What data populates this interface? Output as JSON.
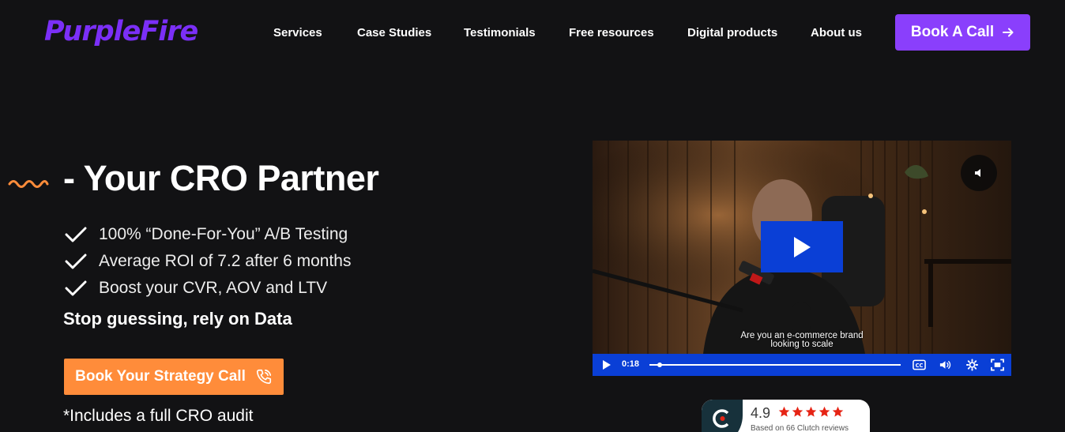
{
  "brand": {
    "logo_text": "PurpleFire",
    "accent": "#8a3ffc",
    "orange": "#ff8c3a",
    "video_blue": "#0a3fd6"
  },
  "nav": {
    "items": [
      {
        "label": "Services"
      },
      {
        "label": "Case Studies"
      },
      {
        "label": "Testimonials"
      },
      {
        "label": "Free resources"
      },
      {
        "label": "Digital products"
      },
      {
        "label": "About us"
      }
    ],
    "cta_label": "Book A Call",
    "cta_icon": "arrow-right-icon"
  },
  "hero": {
    "title": "- Your CRO Partner",
    "features": [
      {
        "text": "100% “Done-For-You” A/B Testing",
        "icon": "checkmark-icon"
      },
      {
        "text": "Average ROI of 7.2 after 6 months",
        "icon": "checkmark-icon"
      },
      {
        "text": "Boost your CVR, AOV and LTV",
        "icon": "checkmark-icon"
      }
    ],
    "tagline": "Stop guessing, rely on Data",
    "cta_label": "Book Your Strategy Call",
    "cta_icon": "phone-icon",
    "note": "*Includes a full CRO audit"
  },
  "video": {
    "caption_line1": "Are you an e-commerce brand",
    "caption_line2": "looking to scale",
    "time": "0:18",
    "progress": 0.04,
    "controls": [
      "play-icon",
      "closed-captions-icon",
      "volume-icon",
      "settings-gear-icon",
      "fullscreen-icon"
    ]
  },
  "clutch": {
    "rating": "4.9",
    "stars": 5,
    "reviews_text": "Based on 66 Clutch reviews",
    "star_color": "#e62415"
  }
}
